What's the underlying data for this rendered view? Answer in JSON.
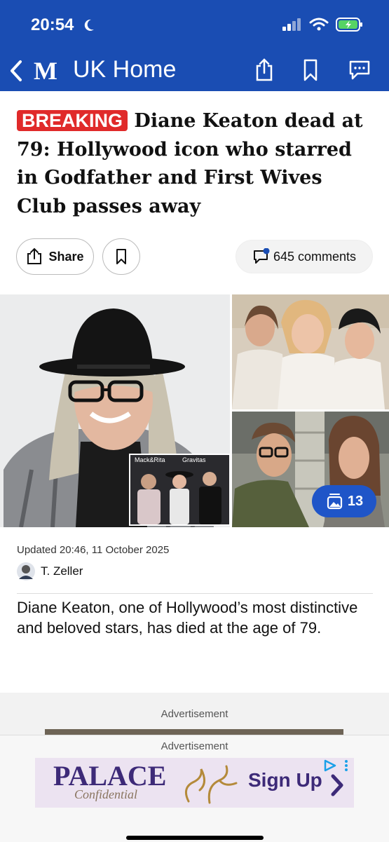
{
  "status": {
    "time": "20:54"
  },
  "nav": {
    "title": "UK Home",
    "logo": "M"
  },
  "article": {
    "badge": "BREAKING",
    "headline": "Diane Keaton dead at 79: Hollywood icon who starred in Godfather and First Wives Club passes away",
    "share_label": "Share",
    "comments_label": "645 comments",
    "gallery_count": "13",
    "inset_sign_1": "Mack&Rita",
    "inset_sign_2": "Gravitas",
    "updated": "Updated 20:46, 11 October 2025",
    "author": "T. Zeller",
    "lede": "Diane Keaton, one of Hollywood’s most distinctive and beloved stars, has died at the age of 79."
  },
  "ads": {
    "label_1": "Advertisement",
    "label_2": "Advertisement",
    "brand": "PALACE",
    "brand_sub": "Confidential",
    "cta": "Sign Up"
  },
  "colors": {
    "header": "#1a4db3",
    "breaking": "#e02a2a",
    "gallery_badge": "#1f55c8"
  }
}
